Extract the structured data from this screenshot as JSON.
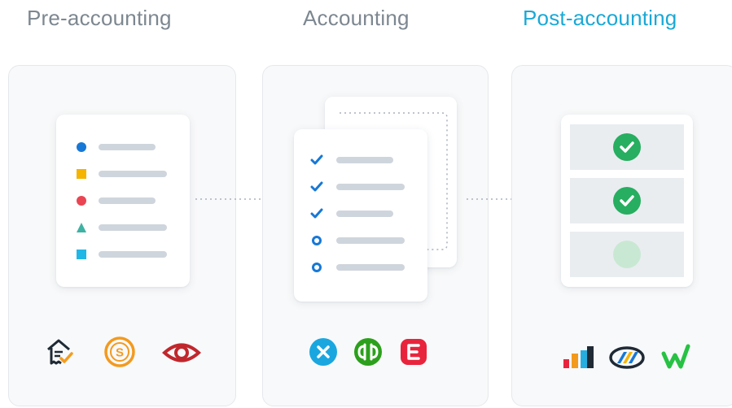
{
  "columns": [
    {
      "title": "Pre-accounting",
      "color": "#7d8790"
    },
    {
      "title": "Accounting",
      "color": "#7d8790"
    },
    {
      "title": "Post-accounting",
      "color": "#1aa9d6"
    }
  ],
  "pre_accounting": {
    "list_markers": [
      "blue-circle",
      "yellow-square",
      "red-circle",
      "teal-triangle",
      "cyan-square"
    ],
    "marker_colors": [
      "#1778d6",
      "#f5b400",
      "#ea4553",
      "#3fb2a3",
      "#20b7e6"
    ],
    "logos": [
      "receipt-check-logo",
      "dollar-coin-logo",
      "red-eye-logo"
    ]
  },
  "accounting": {
    "list_markers": [
      "check",
      "check",
      "check",
      "ring",
      "ring"
    ],
    "marker_color": "#1778d6",
    "logos": [
      "blue-x-logo",
      "green-qb-logo",
      "red-e-logo"
    ]
  },
  "post_accounting": {
    "slots": [
      "checked",
      "checked",
      "pending"
    ],
    "check_color": "#27ae60",
    "pending_color": "#c9e8d3",
    "logos": [
      "bar-chart-logo",
      "oval-stripes-logo",
      "green-w-logo"
    ]
  }
}
